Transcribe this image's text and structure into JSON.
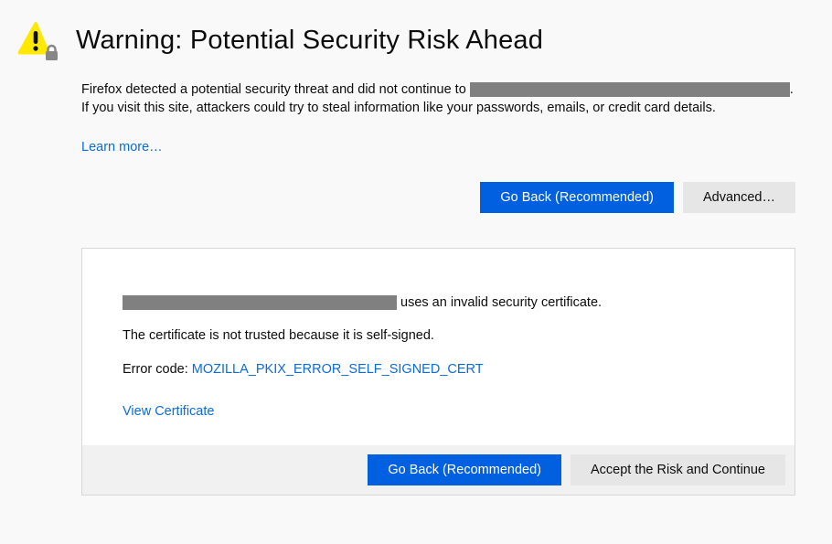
{
  "header": {
    "title": "Warning: Potential Security Risk Ahead"
  },
  "description": {
    "before_redact": "Firefox detected a potential security threat and did not continue to ",
    "after_redact": ". If you visit this site, attackers could try to steal information like your passwords, emails, or credit card details."
  },
  "learn_more": "Learn more…",
  "buttons": {
    "go_back": "Go Back (Recommended)",
    "advanced": "Advanced…",
    "accept_risk": "Accept the Risk and Continue"
  },
  "panel": {
    "cert_msg_after_redact": " uses an invalid security certificate.",
    "not_trusted": "The certificate is not trusted because it is self-signed.",
    "error_label": "Error code: ",
    "error_code": "MOZILLA_PKIX_ERROR_SELF_SIGNED_CERT",
    "view_cert": "View Certificate"
  }
}
